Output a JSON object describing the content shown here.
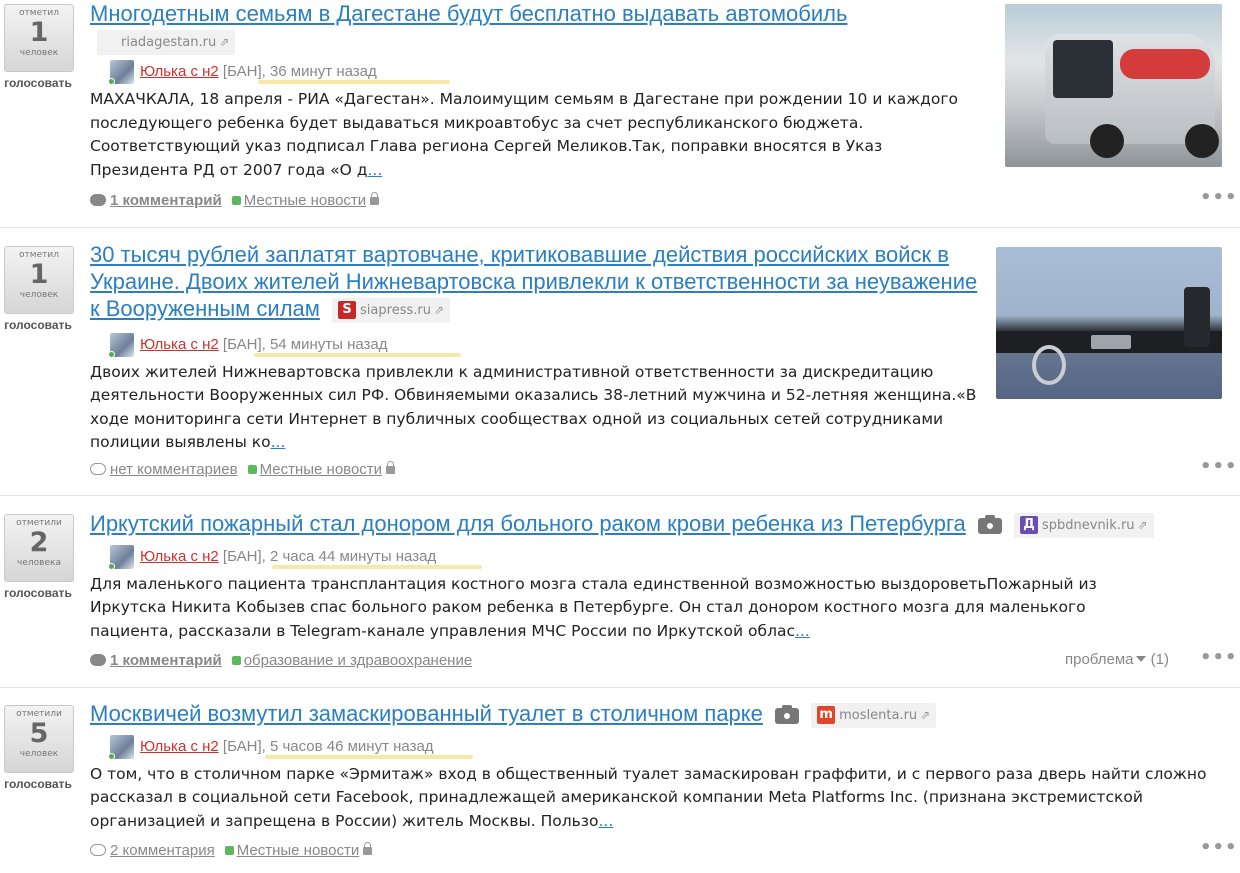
{
  "stories": [
    {
      "votes": {
        "top": "отметил",
        "count": "1",
        "bottom": "человек",
        "button": "голосовать"
      },
      "title": "Многодетным семьям в Дагестане будут бесплатно выдавать автомобиль",
      "source": "riadagestan.ru",
      "author": "Юлька с н2",
      "ban": "[БАН],",
      "time": "36 минут назад",
      "summary": "МАХАЧКАЛА, 18 апреля - РИА «Дагестан». Малоимущим семьям в Дагестане при рождении 10 и каждого последующего ребенка будет выдаваться микроавтобус за счет республиканского бюджета. Соответствующий указ подписал Глава региона Сергей Меликов.Так, поправки вносятся в Указ Президента РД от 2007 года «О д",
      "more": "...",
      "comments": "1 комментарий",
      "category": "Местные новости"
    },
    {
      "votes": {
        "top": "отметил",
        "count": "1",
        "bottom": "человек",
        "button": "голосовать"
      },
      "title": "30 тысяч рублей заплатят вартовчане, критиковавшие действия российских войск в Украине. Двоих жителей Нижневартовска привлекли к ответственности за неуважение к Вооруженным силам",
      "source": "siapress.ru",
      "source_icon": "S",
      "author": "Юлька с н2",
      "ban": "[БАН],",
      "time": "54 минуты назад",
      "summary": "Двоих жителей Нижневартовска привлекли к административной ответственности за дискредитацию деятельности Вооруженных сил РФ. Обвиняемыми оказались 38-летний мужчина и 52-летняя женщина.«В ходе мониторинга сети Интернет в публичных сообществах одной из социальных сетей сотрудниками полиции выявлены ко",
      "more": "...",
      "comments": "нет комментариев",
      "category": "Местные новости"
    },
    {
      "votes": {
        "top": "отметили",
        "count": "2",
        "bottom": "человека",
        "button": "голосовать"
      },
      "title": "Иркутский пожарный стал донором для больного раком крови ребенка из Петербурга",
      "source": "spbdnevnik.ru",
      "source_icon": "Д",
      "author": "Юлька с н2",
      "ban": "[БАН],",
      "time": "2 часа 44 минуты назад",
      "summary": "Для маленького пациента трансплантация костного мозга стала единственной возможностью выздороветьПожарный из Иркутска Никита Кобызев спас больного раком ребенка в Петербурге. Он стал донором костного мозга для маленького пациента, рассказали в Telegram-канале управления МЧС России по Иркутской облас",
      "more": "...",
      "comments": "1 комментарий",
      "category": "образование и здравоохранение",
      "problem": "проблема",
      "problem_count": "(1)"
    },
    {
      "votes": {
        "top": "отметили",
        "count": "5",
        "bottom": "человек",
        "button": "голосовать"
      },
      "title": "Москвичей возмутил замаскированный туалет в столичном парке",
      "source": "moslenta.ru",
      "source_icon": "m",
      "author": "Юлька с н2",
      "ban": "[БАН],",
      "time": "5 часов 46 минут назад",
      "summary": "О том, что в столичном парке «Эрмитаж» вход в общественный туалет замаскирован граффити, и с первого раза дверь найти сложно рассказал в социальной сети Facebook, принадлежащей американской компании Meta Platforms Inc. (признана экстремистской организацией и запрещена в России) житель Москвы. Пользо",
      "more": "...",
      "comments": "2 комментария",
      "category": "Местные новости"
    }
  ],
  "colors": {
    "link": "#2a7fc1",
    "author": "#d0312d",
    "category_dot": "#5cb85c",
    "highlight": "#f7e8a6"
  },
  "icons": {
    "comment": "comment-bubble-icon",
    "lock": "lock-icon",
    "external": "external-link-icon",
    "camera": "camera-icon",
    "menu": "more-dots-icon"
  }
}
